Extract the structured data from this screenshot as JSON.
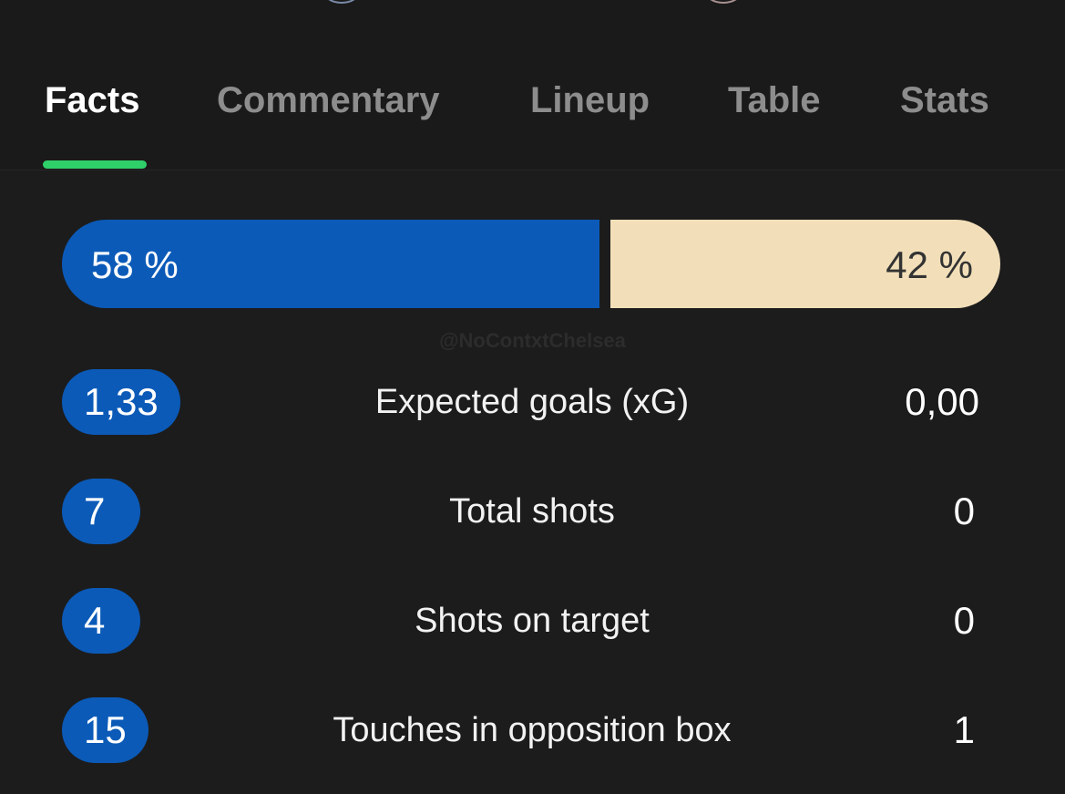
{
  "tabs": [
    {
      "label": "Facts",
      "active": true
    },
    {
      "label": "Commentary",
      "active": false
    },
    {
      "label": "Lineup",
      "active": false
    },
    {
      "label": "Table",
      "active": false
    },
    {
      "label": "Stats",
      "active": false
    }
  ],
  "colors": {
    "home": "#0b5ab8",
    "away": "#f2dfb9",
    "active_tab_indicator": "#2fcf6a",
    "background": "#1c1c1c"
  },
  "possession": {
    "home_percent": 58,
    "away_percent": 42,
    "home_label": "58 %",
    "away_label": "42 %"
  },
  "watermark": "@NoContxtChelsea",
  "stats": [
    {
      "label": "Expected goals (xG)",
      "home": "1,33",
      "away": "0,00"
    },
    {
      "label": "Total shots",
      "home": "7",
      "away": "0"
    },
    {
      "label": "Shots on target",
      "home": "4",
      "away": "0"
    },
    {
      "label": "Touches in opposition box",
      "home": "15",
      "away": "1"
    }
  ]
}
